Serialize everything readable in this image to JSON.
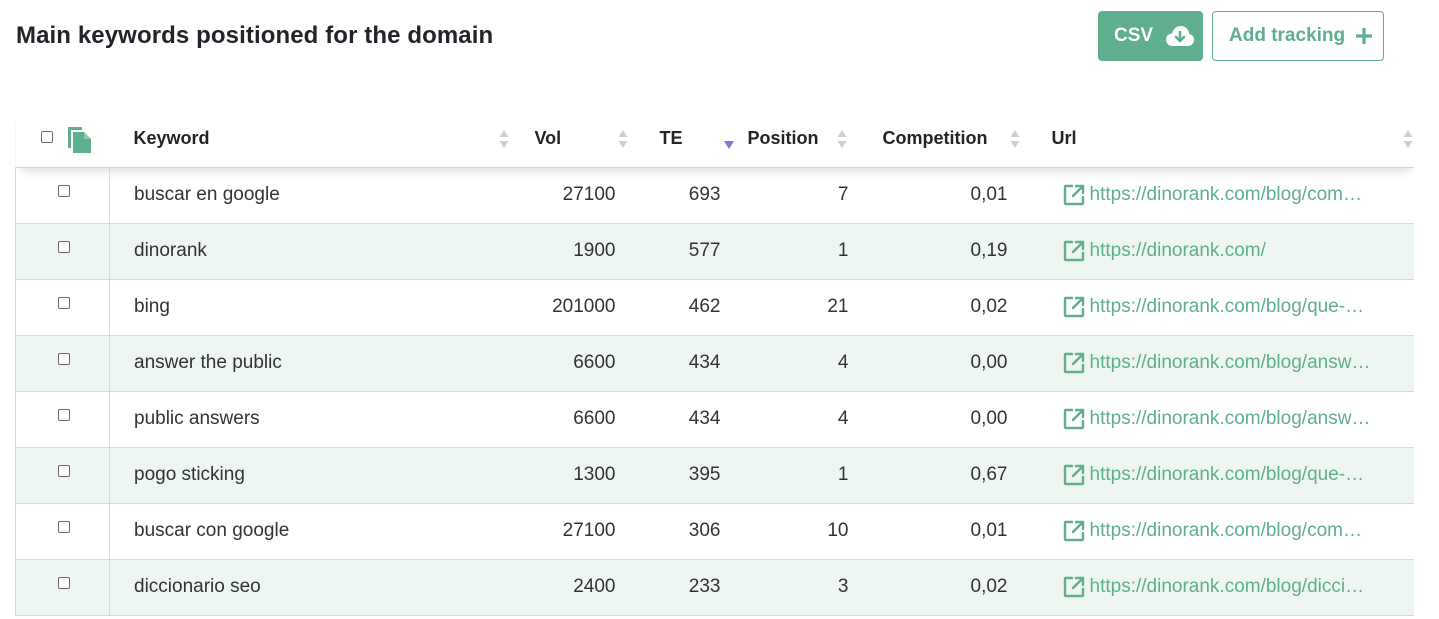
{
  "header": {
    "title": "Main keywords positioned for the domain",
    "csv_label": "CSV",
    "add_tracking_label": "Add tracking"
  },
  "colors": {
    "accent": "#5fae8e",
    "row_stripe": "#eef6f1",
    "sort_active": "#7b7bd6"
  },
  "table": {
    "columns": {
      "keyword": "Keyword",
      "vol": "Vol",
      "te": "TE",
      "position": "Position",
      "competition": "Competition",
      "url": "Url"
    },
    "sorted_by": "TE",
    "sort_direction": "desc",
    "rows": [
      {
        "keyword": "buscar en google",
        "vol": "27100",
        "te": "693",
        "position": "7",
        "competition": "0,01",
        "url": "https://dinorank.com/blog/com…"
      },
      {
        "keyword": "dinorank",
        "vol": "1900",
        "te": "577",
        "position": "1",
        "competition": "0,19",
        "url": "https://dinorank.com/"
      },
      {
        "keyword": "bing",
        "vol": "201000",
        "te": "462",
        "position": "21",
        "competition": "0,02",
        "url": "https://dinorank.com/blog/que-…"
      },
      {
        "keyword": "answer the public",
        "vol": "6600",
        "te": "434",
        "position": "4",
        "competition": "0,00",
        "url": "https://dinorank.com/blog/answ…"
      },
      {
        "keyword": "public answers",
        "vol": "6600",
        "te": "434",
        "position": "4",
        "competition": "0,00",
        "url": "https://dinorank.com/blog/answ…"
      },
      {
        "keyword": "pogo sticking",
        "vol": "1300",
        "te": "395",
        "position": "1",
        "competition": "0,67",
        "url": "https://dinorank.com/blog/que-…"
      },
      {
        "keyword": "buscar con google",
        "vol": "27100",
        "te": "306",
        "position": "10",
        "competition": "0,01",
        "url": "https://dinorank.com/blog/com…"
      },
      {
        "keyword": "diccionario seo",
        "vol": "2400",
        "te": "233",
        "position": "3",
        "competition": "0,02",
        "url": "https://dinorank.com/blog/dicci…"
      }
    ]
  }
}
